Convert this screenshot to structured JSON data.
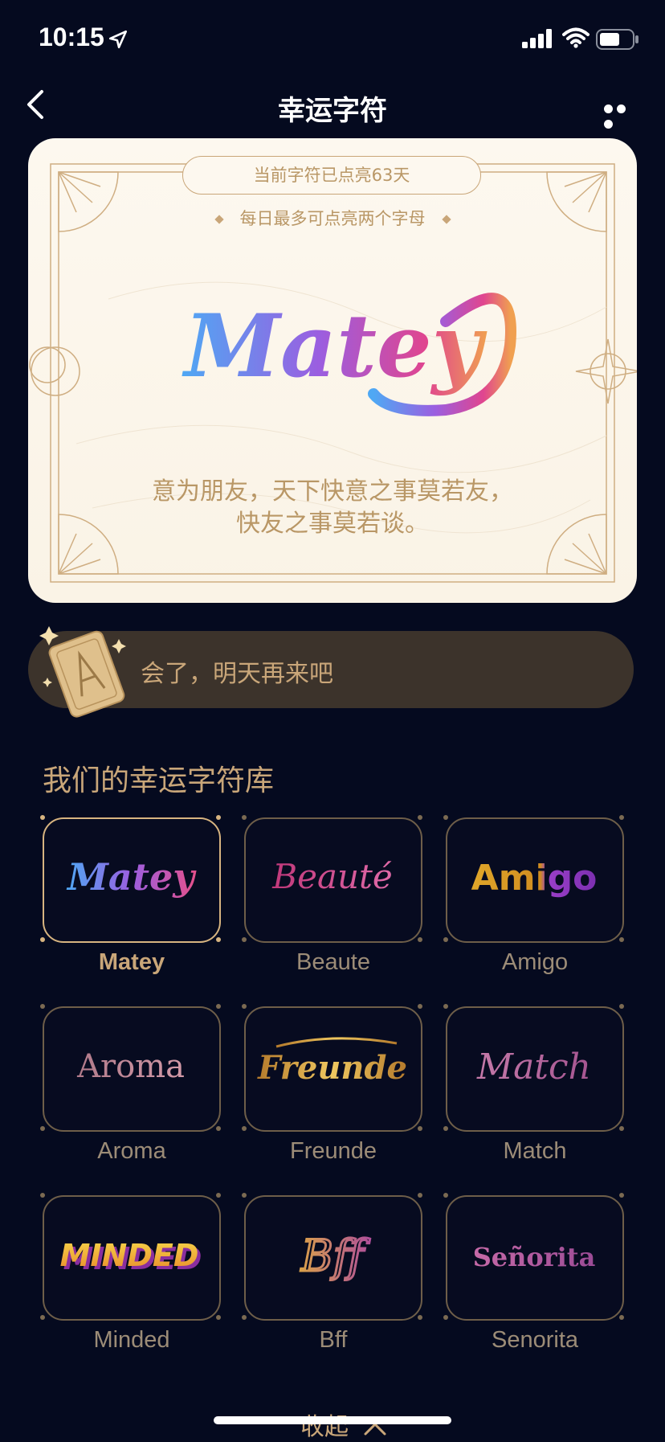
{
  "status_bar": {
    "time": "10:15"
  },
  "nav": {
    "title": "幸运字符"
  },
  "hero": {
    "streak": "当前字符已点亮63天",
    "tip": "每日最多可点亮两个字母",
    "word": "Matey",
    "description_line1": "意为朋友，天下快意之事莫若友，",
    "description_line2": "快友之事莫若谈。"
  },
  "action": {
    "text": "会了，明天再来吧"
  },
  "library": {
    "title": "我们的幸运字符库",
    "items": [
      {
        "label": "Matey",
        "logo": "Matey",
        "selected": true
      },
      {
        "label": "Beaute",
        "logo": "Beauté"
      },
      {
        "label": "Amigo",
        "logo": "Amigo"
      },
      {
        "label": "Aroma",
        "logo": "Aroma"
      },
      {
        "label": "Freunde",
        "logo": "Freunde"
      },
      {
        "label": "Match",
        "logo": "Match"
      },
      {
        "label": "Minded",
        "logo": "MINDED"
      },
      {
        "label": "Bff",
        "logo": "Bff"
      },
      {
        "label": "Senorita",
        "logo": "Señorita"
      }
    ]
  },
  "footer": {
    "collapse_label": "收起"
  },
  "colors": {
    "background": "#050a1f",
    "gold": "#c9a679",
    "card": "#fdf8ef"
  }
}
